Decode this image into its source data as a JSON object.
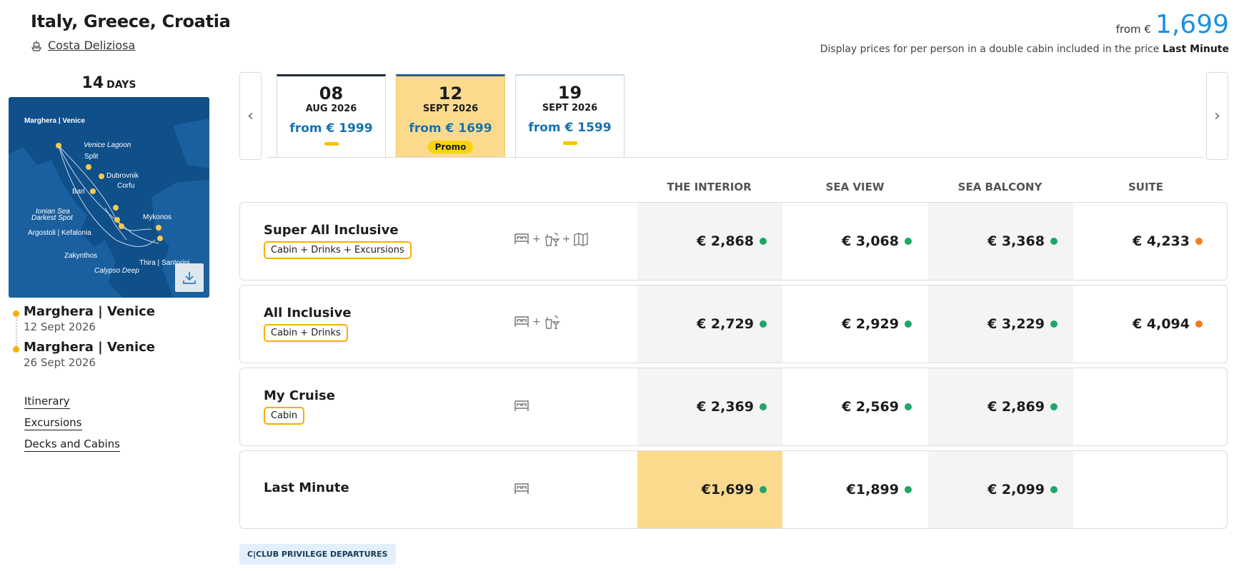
{
  "header": {
    "title": "Italy, Greece, Croatia",
    "ship": "Costa Deliziosa",
    "from_label": "from €",
    "from_price": "1,699",
    "note_prefix": "Display prices for per person in a double cabin included in the price",
    "note_bold": "Last Minute"
  },
  "trip": {
    "days_number": "14",
    "days_unit": "DAYS",
    "map_labels": [
      "Marghera | Venice",
      "Venice Lagoon",
      "Split",
      "Dubrovnik",
      "Corfu",
      "Bari",
      "Ionian Sea",
      "Darkest Spot",
      "Mykonos",
      "Argostoli | Kefalonia",
      "Zakynthos",
      "Thira | Santorini",
      "Calypso Deep"
    ],
    "departure": {
      "port": "Marghera | Venice",
      "date": "12 Sept 2026"
    },
    "arrival": {
      "port": "Marghera | Venice",
      "date": "26 Sept 2026"
    }
  },
  "links": [
    "Itinerary",
    "Excursions",
    "Decks and Cabins"
  ],
  "dates": [
    {
      "day": "08",
      "month": "AUG 2026",
      "price": "from € 1999",
      "badge": "",
      "selected": false
    },
    {
      "day": "12",
      "month": "SEPT 2026",
      "price": "from € 1699",
      "badge": "Promo",
      "selected": true
    },
    {
      "day": "19",
      "month": "SEPT 2026",
      "price": "from € 1599",
      "badge": "",
      "selected": false
    }
  ],
  "columns": [
    "THE INTERIOR",
    "SEA VIEW",
    "SEA BALCONY",
    "SUITE"
  ],
  "packages": [
    {
      "name": "Super All Inclusive",
      "tag": "Cabin + Drinks + Excursions",
      "icons": [
        "bed-icon",
        "drinks-icon",
        "map-icon"
      ],
      "prices": [
        {
          "value": "€ 2,868",
          "status": "green"
        },
        {
          "value": "€ 3,068",
          "status": "green"
        },
        {
          "value": "€ 3,368",
          "status": "green"
        },
        {
          "value": "€ 4,233",
          "status": "orange"
        }
      ]
    },
    {
      "name": "All Inclusive",
      "tag": "Cabin + Drinks",
      "icons": [
        "bed-icon",
        "drinks-icon"
      ],
      "prices": [
        {
          "value": "€ 2,729",
          "status": "green"
        },
        {
          "value": "€ 2,929",
          "status": "green"
        },
        {
          "value": "€ 3,229",
          "status": "green"
        },
        {
          "value": "€ 4,094",
          "status": "orange"
        }
      ]
    },
    {
      "name": "My Cruise",
      "tag": "Cabin",
      "icons": [
        "bed-icon"
      ],
      "prices": [
        {
          "value": "€ 2,369",
          "status": "green"
        },
        {
          "value": "€ 2,569",
          "status": "green"
        },
        {
          "value": "€ 2,869",
          "status": "green"
        }
      ]
    },
    {
      "name": "Last Minute",
      "tag": "",
      "icons": [
        "bed-icon"
      ],
      "prices": [
        {
          "value": "€1,699",
          "status": "green"
        },
        {
          "value": "€1,899",
          "status": "green"
        },
        {
          "value": "€ 2,099",
          "status": "green"
        }
      ]
    }
  ],
  "footer_badge": "C|CLUB PRIVILEGE DEPARTURES",
  "colors": {
    "accent_blue": "#1a8fe0",
    "price_blue": "#1573b0",
    "highlight": "#fcda8d",
    "status_green": "#1da668",
    "status_orange": "#f07e1c",
    "tag_border": "#f5b000"
  }
}
